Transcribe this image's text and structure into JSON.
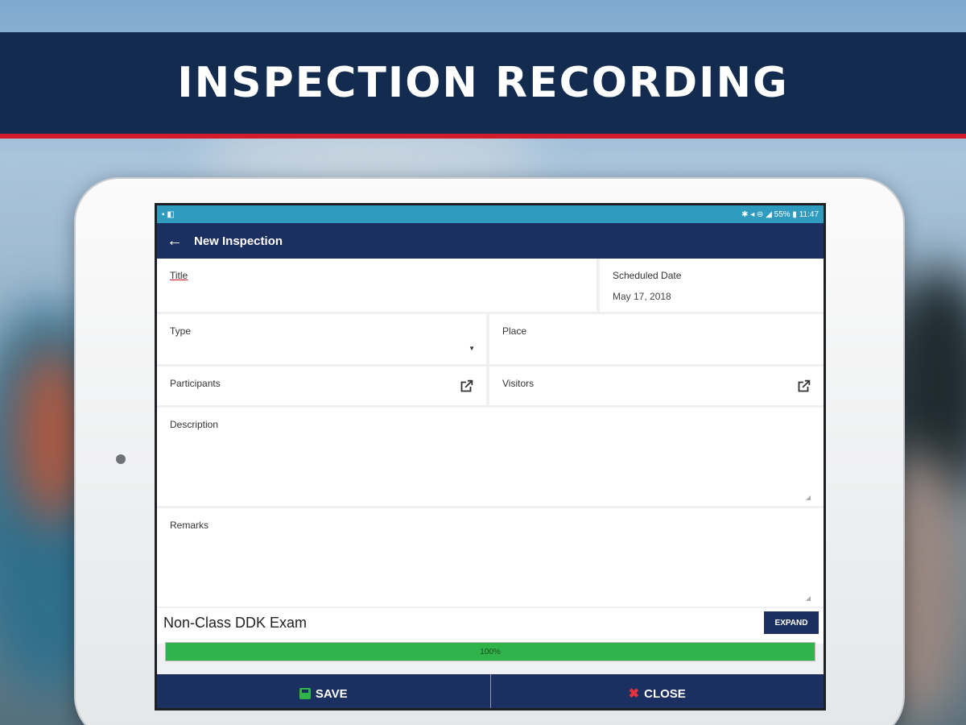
{
  "banner": {
    "title": "INSPECTION RECORDING"
  },
  "statusbar": {
    "left": "▪ ◧",
    "right": "✱ ◂ ⊜ ◢ 55% ▮ 11:47"
  },
  "appbar": {
    "back_icon": "←",
    "title": "New Inspection"
  },
  "form": {
    "title_label": "Title",
    "scheduled_label": "Scheduled Date",
    "scheduled_value": "May 17, 2018",
    "type_label": "Type",
    "place_label": "Place",
    "participants_label": "Participants",
    "visitors_label": "Visitors",
    "description_label": "Description",
    "remarks_label": "Remarks"
  },
  "exam": {
    "title": "Non-Class DDK Exam",
    "expand_label": "EXPAND"
  },
  "progress": {
    "value": 1.0,
    "label": "100%"
  },
  "actions": {
    "save_label": "SAVE",
    "close_label": "CLOSE"
  },
  "colors": {
    "banner": "#122b4f",
    "accent_red": "#d41b2c",
    "appbar": "#1b2f60",
    "progress": "#2fb34a"
  }
}
